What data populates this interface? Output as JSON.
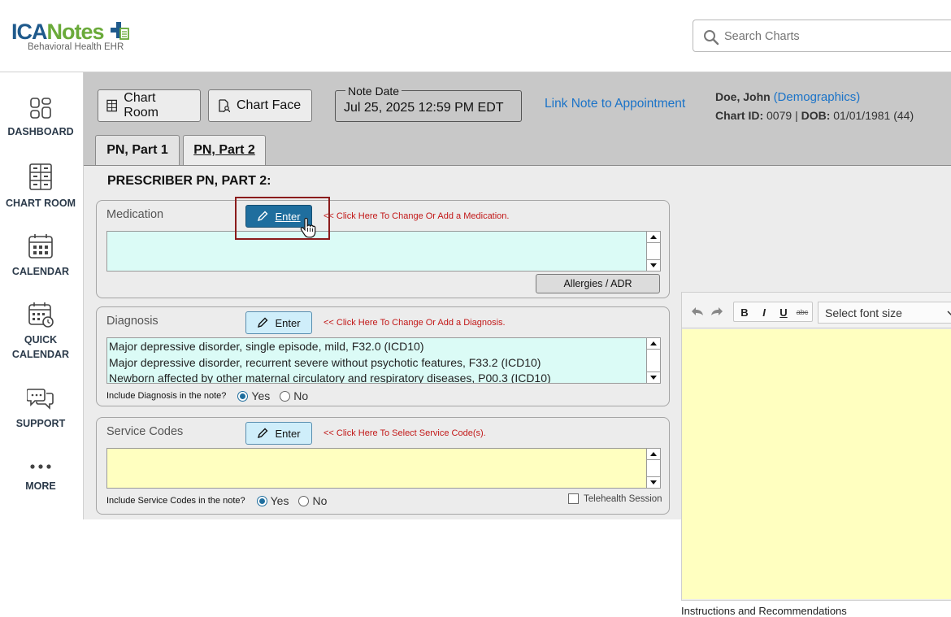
{
  "brand": {
    "logo_part1": "ICA",
    "logo_part2": "Notes",
    "tagline": "Behavioral Health EHR"
  },
  "search": {
    "placeholder": "Search Charts"
  },
  "sidebar": {
    "items": [
      {
        "label": "DASHBOARD",
        "icon": "dashboard-icon"
      },
      {
        "label": "CHART ROOM",
        "icon": "file-cabinet-icon"
      },
      {
        "label": "CALENDAR",
        "icon": "calendar-icon"
      },
      {
        "label": "QUICK",
        "label2": "CALENDAR",
        "icon": "quick-calendar-icon"
      },
      {
        "label": "SUPPORT",
        "icon": "chat-bubbles-icon"
      },
      {
        "label": "MORE",
        "icon": "more-dots-icon"
      }
    ]
  },
  "toolbar": {
    "chart_room": "Chart Room",
    "chart_face": "Chart Face",
    "note_date_label": "Note Date",
    "note_date_value": "Jul 25, 2025 12:59 PM EDT",
    "link_appointment": "Link Note to Appointment"
  },
  "patient": {
    "name": "Doe, John",
    "demographics_link": "(Demographics)",
    "chart_id_label": "Chart ID:",
    "chart_id": "0079",
    "dob_label": "DOB:",
    "dob": "01/01/1981 (44)"
  },
  "tabs": [
    {
      "label": "PN, Part 1",
      "active": false
    },
    {
      "label": "PN, Part 2",
      "active": true
    }
  ],
  "section_title": "PRESCRIBER PN, PART 2:",
  "medication": {
    "label": "Medication",
    "enter": "Enter",
    "hint": "<< Click Here To Change Or Add a Medication.",
    "allergies_button": "Allergies / ADR"
  },
  "diagnosis": {
    "label": "Diagnosis",
    "enter": "Enter",
    "hint": "<< Click Here To Change Or Add a Diagnosis.",
    "lines": [
      "Major depressive disorder, single episode, mild, F32.0 (ICD10)",
      "Major depressive disorder, recurrent severe without psychotic features, F33.2 (ICD10)",
      "Newborn affected by other maternal circulatory and respiratory diseases, P00.3 (ICD10)"
    ],
    "include_label": "Include Diagnosis in the note?",
    "yes": "Yes",
    "no": "No",
    "selected": "Yes"
  },
  "service_codes": {
    "label": "Service Codes",
    "enter": "Enter",
    "hint": "<< Click Here To Select Service Code(s).",
    "include_label": "Include Service Codes in the note?",
    "yes": "Yes",
    "no": "No",
    "selected": "Yes",
    "telehealth": "Telehealth Session"
  },
  "editor": {
    "font_size_placeholder": "Select font size",
    "bold": "B",
    "italic": "I",
    "underline": "U",
    "strike": "abc",
    "footer_label": "Instructions and Recommendations"
  },
  "colors": {
    "brand_blue": "#1f5a8c",
    "brand_green": "#6aaa3a",
    "link_blue": "#1a73c8",
    "hint_red": "#c21818",
    "mint_field": "#dbfbf6",
    "yellow_field": "#ffffc0"
  }
}
